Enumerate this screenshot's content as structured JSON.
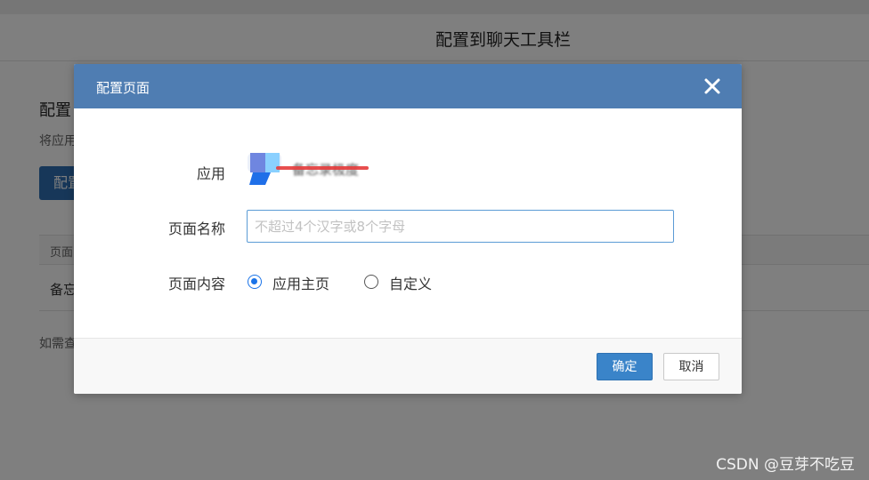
{
  "page": {
    "title": "配置到聊天工具栏",
    "section_title": "配置",
    "description": "将应用",
    "primary_button": "配置",
    "table_header": "页面",
    "table_row": "备忘",
    "footnote": "如需查"
  },
  "dialog": {
    "title": "配置页面",
    "close_icon": "close-icon",
    "fields": {
      "app_label": "应用",
      "app_name": "备忘录极度",
      "page_name_label": "页面名称",
      "page_name_value": "",
      "page_name_placeholder": "不超过4个汉字或8个字母",
      "page_content_label": "页面内容"
    },
    "radio_options": [
      {
        "label": "应用主页",
        "selected": true
      },
      {
        "label": "自定义",
        "selected": false
      }
    ],
    "buttons": {
      "ok": "确定",
      "cancel": "取消"
    }
  },
  "watermark": "CSDN @豆芽不吃豆",
  "colors": {
    "header_blue": "#4f7db2",
    "primary_button": "#3a84c9",
    "radio_accent": "#1a73e8",
    "redaction_line": "#e53b3b"
  }
}
